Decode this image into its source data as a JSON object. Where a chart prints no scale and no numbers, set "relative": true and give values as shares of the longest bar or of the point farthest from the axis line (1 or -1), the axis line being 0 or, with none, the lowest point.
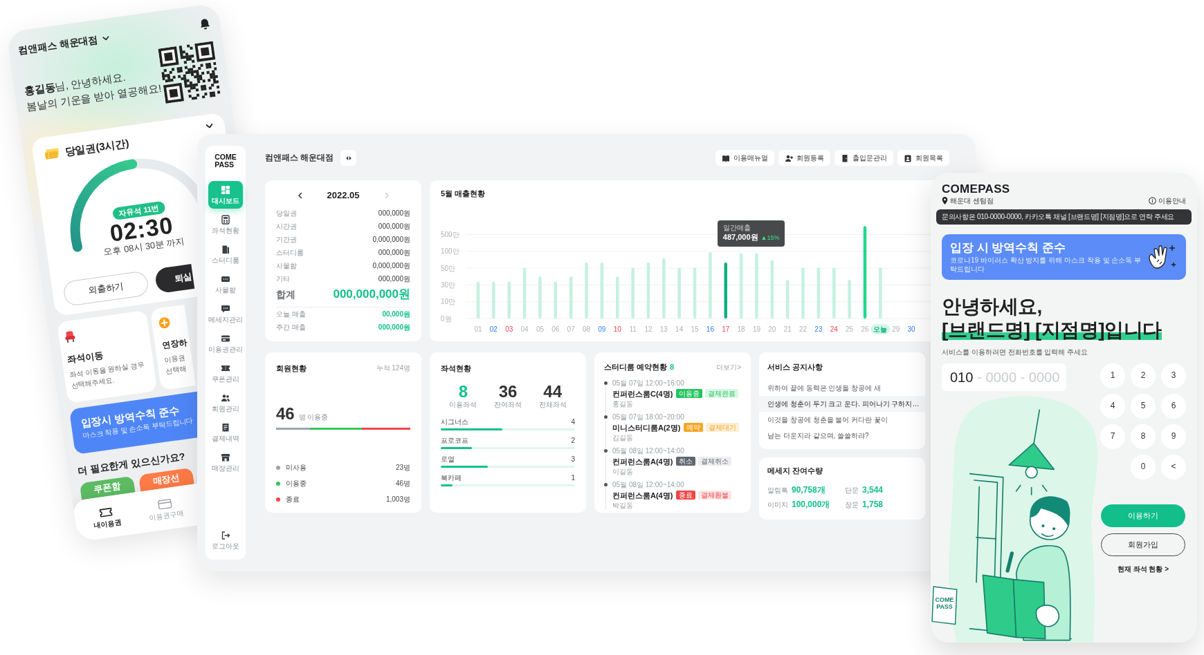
{
  "phone": {
    "store": "컴앤패스 해운대점",
    "greeting": [
      "**홍길동**님, 안녕하세요.",
      "봄날의 기운을 받아 열공해요!"
    ],
    "pass": {
      "title": "당일권(3시간)",
      "level": 0.5,
      "seat": "자유석 11번",
      "remaining": "02:30",
      "until": "오후 08시 30분 까지",
      "buttons": [
        {
          "kind": "outline",
          "label": "외출하기"
        },
        {
          "kind": "dark",
          "label": "퇴실"
        }
      ]
    },
    "actions": [
      {
        "kind": "seat",
        "title": "좌석이동",
        "lines": [
          "좌석 이동을 원하실 경우",
          "선택해주세요."
        ]
      },
      {
        "kind": "extend",
        "title": "연장하",
        "lines": [
          "이용권",
          "선택해"
        ]
      }
    ],
    "banner": {
      "title": "입장시 방역수칙 준수",
      "text": "마스크 착용 및 손소독 부탁드립니다"
    },
    "more_title": "더 필요한게 있으신가요?",
    "more_buttons": [
      {
        "label": "쿠폰함",
        "color": "#5dbb63"
      },
      {
        "label": "매장선",
        "color": "#ff7b47"
      }
    ],
    "nav": [
      {
        "kind": "ticket",
        "label": "내이용권",
        "selected": true
      },
      {
        "kind": "card",
        "label": "이용권구매",
        "selected": false
      }
    ]
  },
  "dashboard": {
    "logo": [
      "COME",
      "PASS"
    ],
    "menu": [
      {
        "kind": "dashboard",
        "label": "대시보드",
        "selected": true
      },
      {
        "kind": "seats",
        "label": "좌석현황",
        "selected": false
      },
      {
        "kind": "studyroom",
        "label": "스터디룸",
        "selected": false
      },
      {
        "kind": "locker",
        "label": "사물함",
        "selected": false
      },
      {
        "kind": "message",
        "label": "메세지관리",
        "selected": false
      },
      {
        "kind": "pass",
        "label": "이용권관리",
        "selected": false
      },
      {
        "kind": "coupon",
        "label": "쿠폰관리",
        "selected": false
      },
      {
        "kind": "members",
        "label": "회원관리",
        "selected": false
      },
      {
        "kind": "payments",
        "label": "결제내역",
        "selected": false
      },
      {
        "kind": "store",
        "label": "매장관리",
        "selected": false
      }
    ],
    "logout": "로그아웃",
    "store": "컴앤패스 해운대점",
    "toolbar": [
      {
        "kind": "manual",
        "label": "이용매뉴얼"
      },
      {
        "kind": "add_member",
        "label": "회원등록"
      },
      {
        "kind": "door",
        "label": "출입문관리"
      },
      {
        "kind": "members",
        "label": "회원목록"
      }
    ],
    "sales": {
      "month": "2022.05",
      "next_disabled": true,
      "rows": [
        {
          "label": "당일권",
          "value": "000,000원"
        },
        {
          "label": "시간권",
          "value": "000,000원"
        },
        {
          "label": "기간권",
          "value": "0,000,000원"
        },
        {
          "label": "스터디룸",
          "value": "000,000원"
        },
        {
          "label": "사물함",
          "value": "0,000,000원"
        },
        {
          "label": "기타",
          "value": "000,000원"
        }
      ],
      "total": {
        "label": "합계",
        "value": "000,000,000원"
      },
      "summary": [
        {
          "label": "오늘 매출",
          "value": "00,000원"
        },
        {
          "label": "주간 매출",
          "value": "000,000원"
        }
      ]
    },
    "chart": {
      "chart_data": {
        "type": "bar",
        "title": "5월 매출현황",
        "relative": true,
        "categories": [
          "01",
          "02",
          "03",
          "04",
          "05",
          "06",
          "07",
          "08",
          "09",
          "10",
          "11",
          "12",
          "13",
          "14",
          "15",
          "16",
          "17",
          "18",
          "19",
          "20",
          "21",
          "22",
          "23",
          "24",
          "25",
          "26",
          "오늘",
          "29",
          "30"
        ],
        "values": [
          0.4,
          0.4,
          0.4,
          0.55,
          0.455,
          0.4,
          0.455,
          0.607,
          0.607,
          0.455,
          0.55,
          0.607,
          0.655,
          0.55,
          0.55,
          0.72,
          0.607,
          0.709,
          0.709,
          0.633,
          0.418,
          0.55,
          0.55,
          0.55,
          0.418,
          1.0,
          0.55,
          null,
          null
        ]
      },
      "y_labels": [
        "500만",
        "100만",
        "50만",
        "30만",
        "10만",
        "0원"
      ],
      "days": [
        {
          "kind": "weekday",
          "bar": {
            "kind": "plain"
          }
        },
        {
          "kind": "saturday",
          "bar": {
            "kind": "plain"
          }
        },
        {
          "kind": "sunday",
          "bar": {
            "kind": "plain"
          }
        },
        {
          "kind": "weekday",
          "bar": {
            "kind": "plain"
          }
        },
        {
          "kind": "weekday",
          "bar": {
            "kind": "plain"
          }
        },
        {
          "kind": "weekday",
          "bar": {
            "kind": "plain"
          }
        },
        {
          "kind": "weekday",
          "bar": {
            "kind": "plain"
          }
        },
        {
          "kind": "weekday",
          "bar": {
            "kind": "plain"
          }
        },
        {
          "kind": "saturday",
          "bar": {
            "kind": "plain"
          }
        },
        {
          "kind": "sunday",
          "bar": {
            "kind": "plain"
          }
        },
        {
          "kind": "weekday",
          "bar": {
            "kind": "plain"
          }
        },
        {
          "kind": "weekday",
          "bar": {
            "kind": "plain"
          }
        },
        {
          "kind": "weekday",
          "bar": {
            "kind": "plain"
          }
        },
        {
          "kind": "weekday",
          "bar": {
            "kind": "plain"
          }
        },
        {
          "kind": "weekday",
          "bar": {
            "kind": "plain"
          }
        },
        {
          "kind": "saturday",
          "bar": {
            "kind": "plain"
          }
        },
        {
          "kind": "sunday",
          "bar": {
            "kind": "hover"
          }
        },
        {
          "kind": "weekday",
          "bar": {
            "kind": "plain"
          }
        },
        {
          "kind": "weekday",
          "bar": {
            "kind": "plain"
          }
        },
        {
          "kind": "weekday",
          "bar": {
            "kind": "plain"
          }
        },
        {
          "kind": "weekday",
          "bar": {
            "kind": "plain"
          }
        },
        {
          "kind": "weekday",
          "bar": {
            "kind": "plain"
          }
        },
        {
          "kind": "saturday",
          "bar": {
            "kind": "plain"
          }
        },
        {
          "kind": "sunday",
          "bar": {
            "kind": "plain"
          }
        },
        {
          "kind": "weekday",
          "bar": {
            "kind": "plain"
          }
        },
        {
          "kind": "weekday",
          "bar": {
            "kind": "peak"
          }
        },
        {
          "kind": "today",
          "bar": {
            "kind": "plain"
          }
        },
        {
          "kind": "weekday"
        },
        {
          "kind": "saturday"
        }
      ],
      "tooltip": {
        "title": "일간매출",
        "value": "487,000원",
        "change": "▲15%"
      }
    },
    "members": {
      "title": "회원현황",
      "total": "누적 124명",
      "count": "46",
      "count_label": "명 이용중",
      "legend": [
        {
          "label": "미사용",
          "value": "23명",
          "color": "#9ca3af",
          "level": 0.25
        },
        {
          "label": "이용중",
          "value": "46명",
          "color": "#34c759",
          "level": 0.39
        },
        {
          "label": "종료",
          "value": "1,003명",
          "color": "#f0444f",
          "level": 0.36
        }
      ]
    },
    "seats": {
      "title": "좌석현황",
      "stats": [
        {
          "kind": "accent",
          "value": "8",
          "label": "이용좌석"
        },
        {
          "kind": "plain",
          "value": "36",
          "label": "잔여좌석"
        },
        {
          "kind": "plain",
          "value": "44",
          "label": "전체좌석"
        }
      ],
      "zones": [
        {
          "name": "시그너스",
          "count": "4",
          "level": 0.46
        },
        {
          "name": "프로코프",
          "count": "2",
          "level": 0.23
        },
        {
          "name": "로열",
          "count": "3",
          "level": 0.35
        },
        {
          "name": "북카페",
          "count": "1",
          "level": 0.09
        }
      ]
    },
    "rooms": {
      "title": "스터디룸 예약현황",
      "count": "8",
      "more": "더보기>",
      "items": [
        {
          "time": "05월 07일 12:00~16:00",
          "room": "컨퍼런스룸C(4명)",
          "status": {
            "text": "이용중",
            "color": "#22c55e"
          },
          "payment": {
            "text": "결제완료",
            "color": "#dcf7e4"
          },
          "name": "홍길동"
        },
        {
          "time": "05월 07일 18:00~20:00",
          "room": "미니스터디룸A(2명)",
          "status": {
            "text": "예약",
            "color": "#f5a524"
          },
          "payment": {
            "text": "결제대기",
            "color": "#fdefd6"
          },
          "name": "김길동"
        },
        {
          "time": "05월 08일 12:00~14:00",
          "room": "컨퍼런스룸A(4명)",
          "status": {
            "text": "취소",
            "color": "#5f6670"
          },
          "payment": {
            "text": "결제취소",
            "color": "#edeef0"
          },
          "name": "이길동"
        },
        {
          "time": "05월 08일 12:00~14:00",
          "room": "컨퍼런스룸A(4명)",
          "status": {
            "text": "종료",
            "color": "#ef4444"
          },
          "payment": {
            "text": "결제환불",
            "color": "#fde4e4"
          },
          "name": "박길동"
        }
      ]
    },
    "notices": {
      "title": "서비스 공지사항",
      "items": [
        {
          "text": "위하여 끝에 동력은 인생을 창공에 새",
          "selected": false
        },
        {
          "text": "인생에 청춘이 두기 크고 운다. 피어나기 구하지…",
          "selected": true
        },
        {
          "text": "이것을 창공에 청춘을 불어 커다란 꽃이",
          "selected": false
        },
        {
          "text": "남는 더운지라 같으며, 쓸쓸하랴?",
          "selected": false
        }
      ]
    },
    "messages": {
      "title": "메세지 잔여수량",
      "items": [
        {
          "label": "알림톡",
          "value": "90,758개"
        },
        {
          "label": "단문",
          "value": "3,544"
        },
        {
          "label": "이미지",
          "value": "100,000개"
        },
        {
          "label": "장문",
          "value": "1,758"
        }
      ]
    }
  },
  "kiosk": {
    "logo": "COMEPASS",
    "branch": "해운대 센텀점",
    "guide": "이용안내",
    "contact": "문의사항은 010-0000-0000, 카카오톡 채널 [브랜드명] [지점명]으로 연락 주세요",
    "banner": {
      "title": "입장 시 방역수칙 준수",
      "text": "코로나19 바이러스 확산 방지를 위해 마스크 착용 및 손소독 부탁드립니다"
    },
    "heading": [
      {
        "text": "안녕하세요,",
        "highlighted": false
      },
      {
        "text": "[브랜드명] [지점명]입니다",
        "highlighted": true
      }
    ],
    "instruction": "서비스를 이용하려면 전화번호를 입력해 주세요",
    "phone_field": {
      "value": "010",
      "placeholder": "- 0000 - 0000"
    },
    "keys": [
      "1",
      "2",
      "3",
      "4",
      "5",
      "6",
      "7",
      "8",
      "9",
      "0",
      "<"
    ],
    "buttons": [
      {
        "kind": "primary",
        "label": "이용하기"
      },
      {
        "kind": "outline",
        "label": "회원가입"
      }
    ],
    "seat_link": "현재 좌석 현황 >",
    "cup_logo": [
      "COME",
      "PASS"
    ]
  }
}
